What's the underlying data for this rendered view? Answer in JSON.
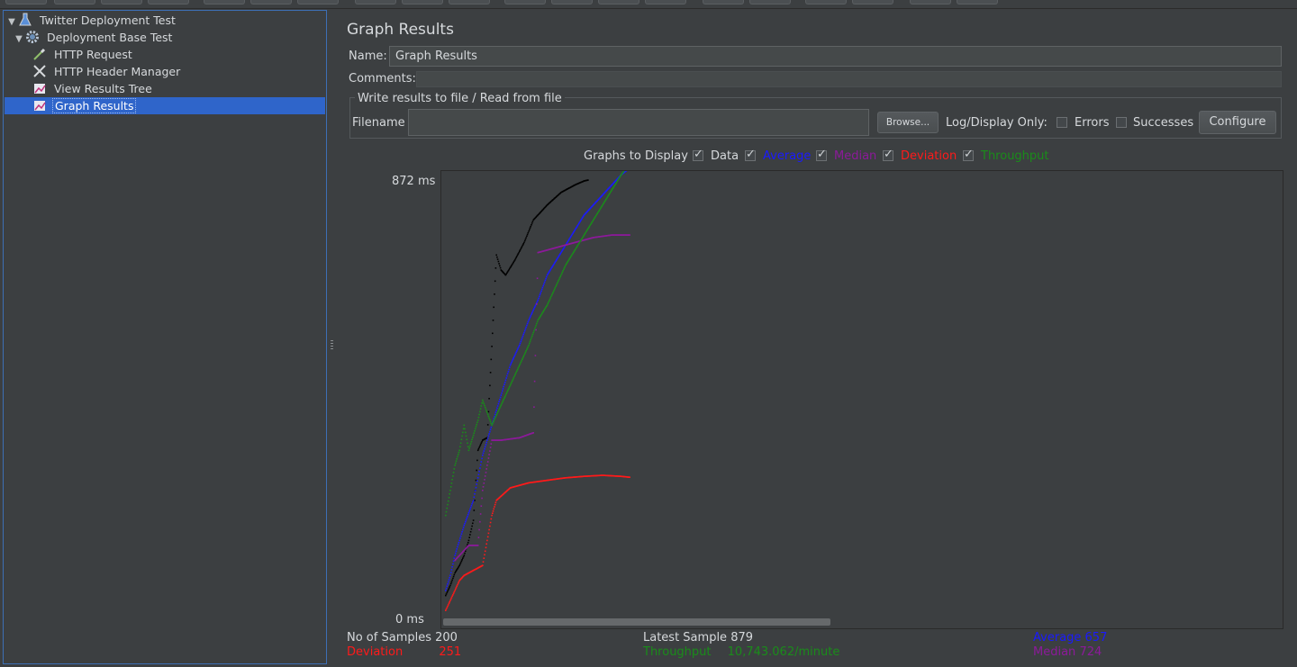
{
  "colors": {
    "data": "#000000",
    "average": "#1a1aff",
    "median": "#8c1a9a",
    "deviation": "#ff1a1a",
    "throughput": "#1a8c1a"
  },
  "tree": {
    "items": [
      {
        "label": "Twitter Deployment Test",
        "icon": "flask-icon"
      },
      {
        "label": "Deployment Base Test",
        "icon": "gear-icon"
      },
      {
        "label": "HTTP Request",
        "icon": "pipette-icon"
      },
      {
        "label": "HTTP Header Manager",
        "icon": "wrench-icon"
      },
      {
        "label": "View Results Tree",
        "icon": "graph-icon"
      },
      {
        "label": "Graph Results",
        "icon": "graph-icon",
        "selected": true
      }
    ]
  },
  "panel": {
    "title": "Graph Results",
    "name_label": "Name:",
    "name_value": "Graph Results",
    "comments_label": "Comments:",
    "file_group_title": "Write results to file / Read from file",
    "filename_label": "Filename",
    "filename_value": "",
    "browse_label": "Browse...",
    "log_display_label": "Log/Display Only:",
    "errors_label": "Errors",
    "successes_label": "Successes",
    "configure_label": "Configure"
  },
  "graphs_to_display": {
    "label": "Graphs to Display",
    "options": [
      {
        "label": "Data",
        "checked": true
      },
      {
        "label": "Average",
        "checked": true
      },
      {
        "label": "Median",
        "checked": true
      },
      {
        "label": "Deviation",
        "checked": true
      },
      {
        "label": "Throughput",
        "checked": true
      }
    ]
  },
  "chart_data": {
    "type": "scatter",
    "y_max_label": "872 ms",
    "y_min_label": "0 ms",
    "ylim": [
      0,
      872
    ],
    "xlim": [
      0,
      200
    ],
    "series": [
      {
        "name": "Data",
        "color": "#000000",
        "points": [
          [
            0,
            40
          ],
          [
            5,
            60
          ],
          [
            10,
            85
          ],
          [
            15,
            100
          ],
          [
            20,
            120
          ],
          [
            25,
            150
          ],
          [
            30,
            190
          ],
          [
            35,
            330
          ],
          [
            40,
            350
          ],
          [
            45,
            355
          ],
          [
            55,
            720
          ],
          [
            60,
            690
          ],
          [
            65,
            680
          ],
          [
            75,
            710
          ],
          [
            85,
            745
          ],
          [
            95,
            790
          ],
          [
            110,
            820
          ],
          [
            125,
            845
          ],
          [
            140,
            860
          ],
          [
            150,
            868
          ],
          [
            155,
            870
          ]
        ]
      },
      {
        "name": "Average",
        "color": "#1a1aff",
        "points": [
          [
            0,
            50
          ],
          [
            5,
            80
          ],
          [
            10,
            120
          ],
          [
            15,
            150
          ],
          [
            20,
            180
          ],
          [
            30,
            230
          ],
          [
            40,
            320
          ],
          [
            50,
            380
          ],
          [
            60,
            440
          ],
          [
            70,
            500
          ],
          [
            80,
            540
          ],
          [
            90,
            590
          ],
          [
            100,
            630
          ],
          [
            110,
            680
          ],
          [
            120,
            710
          ],
          [
            130,
            740
          ],
          [
            140,
            770
          ],
          [
            150,
            800
          ],
          [
            160,
            820
          ],
          [
            170,
            840
          ],
          [
            180,
            860
          ],
          [
            190,
            880
          ],
          [
            200,
            895
          ]
        ]
      },
      {
        "name": "Median",
        "color": "#8c1a9a",
        "points": [
          [
            10,
            110
          ],
          [
            25,
            140
          ],
          [
            35,
            140
          ],
          [
            40,
            250
          ],
          [
            50,
            350
          ],
          [
            60,
            350
          ],
          [
            80,
            355
          ],
          [
            95,
            365
          ],
          [
            100,
            725
          ],
          [
            120,
            735
          ],
          [
            140,
            745
          ],
          [
            160,
            755
          ],
          [
            180,
            760
          ],
          [
            200,
            760
          ]
        ]
      },
      {
        "name": "Deviation",
        "color": "#ff1a1a",
        "points": [
          [
            0,
            10
          ],
          [
            5,
            30
          ],
          [
            10,
            50
          ],
          [
            15,
            70
          ],
          [
            20,
            80
          ],
          [
            35,
            95
          ],
          [
            40,
            100
          ],
          [
            45,
            150
          ],
          [
            50,
            200
          ],
          [
            55,
            230
          ],
          [
            70,
            255
          ],
          [
            90,
            265
          ],
          [
            110,
            270
          ],
          [
            130,
            275
          ],
          [
            150,
            278
          ],
          [
            170,
            280
          ],
          [
            190,
            278
          ],
          [
            200,
            276
          ]
        ]
      },
      {
        "name": "Throughput",
        "color": "#1a8c1a",
        "points": [
          [
            0,
            200
          ],
          [
            5,
            250
          ],
          [
            10,
            300
          ],
          [
            15,
            330
          ],
          [
            20,
            380
          ],
          [
            25,
            330
          ],
          [
            30,
            360
          ],
          [
            35,
            390
          ],
          [
            40,
            430
          ],
          [
            50,
            380
          ],
          [
            60,
            420
          ],
          [
            70,
            460
          ],
          [
            80,
            500
          ],
          [
            90,
            540
          ],
          [
            100,
            590
          ],
          [
            110,
            620
          ],
          [
            120,
            660
          ],
          [
            130,
            700
          ],
          [
            140,
            730
          ],
          [
            150,
            760
          ],
          [
            160,
            790
          ],
          [
            170,
            820
          ],
          [
            180,
            850
          ],
          [
            190,
            880
          ],
          [
            200,
            905
          ]
        ]
      }
    ]
  },
  "stats": {
    "samples_label": "No of Samples",
    "samples_value": "200",
    "latest_label": "Latest Sample",
    "latest_value": "879",
    "average_label": "Average",
    "average_value": "657",
    "deviation_label": "Deviation",
    "deviation_value": "251",
    "throughput_label": "Throughput",
    "throughput_value": "10,743.062/minute",
    "median_label": "Median",
    "median_value": "724"
  }
}
